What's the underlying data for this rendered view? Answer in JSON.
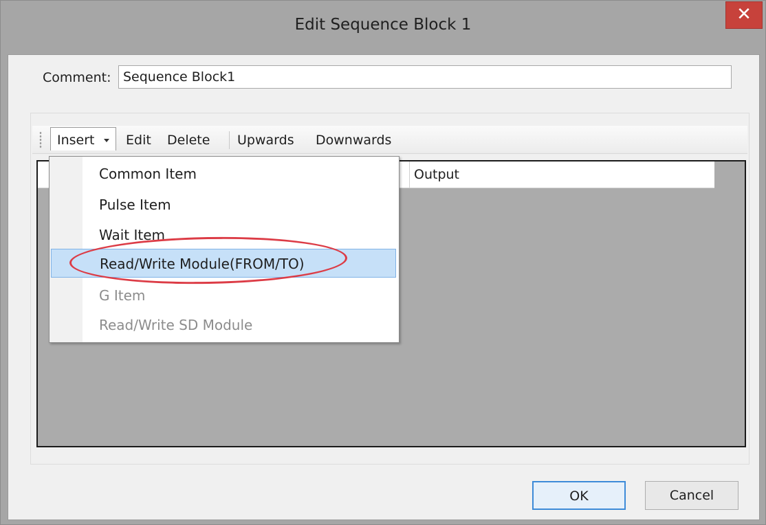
{
  "window": {
    "title": "Edit Sequence Block 1",
    "close_glyph": "✕"
  },
  "comment": {
    "label": "Comment:",
    "value": "Sequence Block1"
  },
  "toolbar": {
    "insert": "Insert",
    "edit": "Edit",
    "delete": "Delete",
    "upwards": "Upwards",
    "downwards": "Downwards"
  },
  "grid": {
    "columns": [
      "",
      "Output"
    ]
  },
  "insert_menu": {
    "items": [
      {
        "label": "Common Item",
        "enabled": true,
        "highlighted": false
      },
      {
        "label": "Pulse Item",
        "enabled": true,
        "highlighted": false
      },
      {
        "label": "Wait Item",
        "enabled": true,
        "highlighted": false
      },
      {
        "label": "Read/Write Module(FROM/TO)",
        "enabled": true,
        "highlighted": true
      },
      {
        "label": "G Item",
        "enabled": false,
        "highlighted": false
      },
      {
        "label": "Read/Write SD Module",
        "enabled": false,
        "highlighted": false
      }
    ]
  },
  "buttons": {
    "ok": "OK",
    "cancel": "Cancel"
  },
  "colors": {
    "annotation_ring": "#dc3c46",
    "menu_hover": "#c6e0f8",
    "close_button": "#c7423b"
  }
}
